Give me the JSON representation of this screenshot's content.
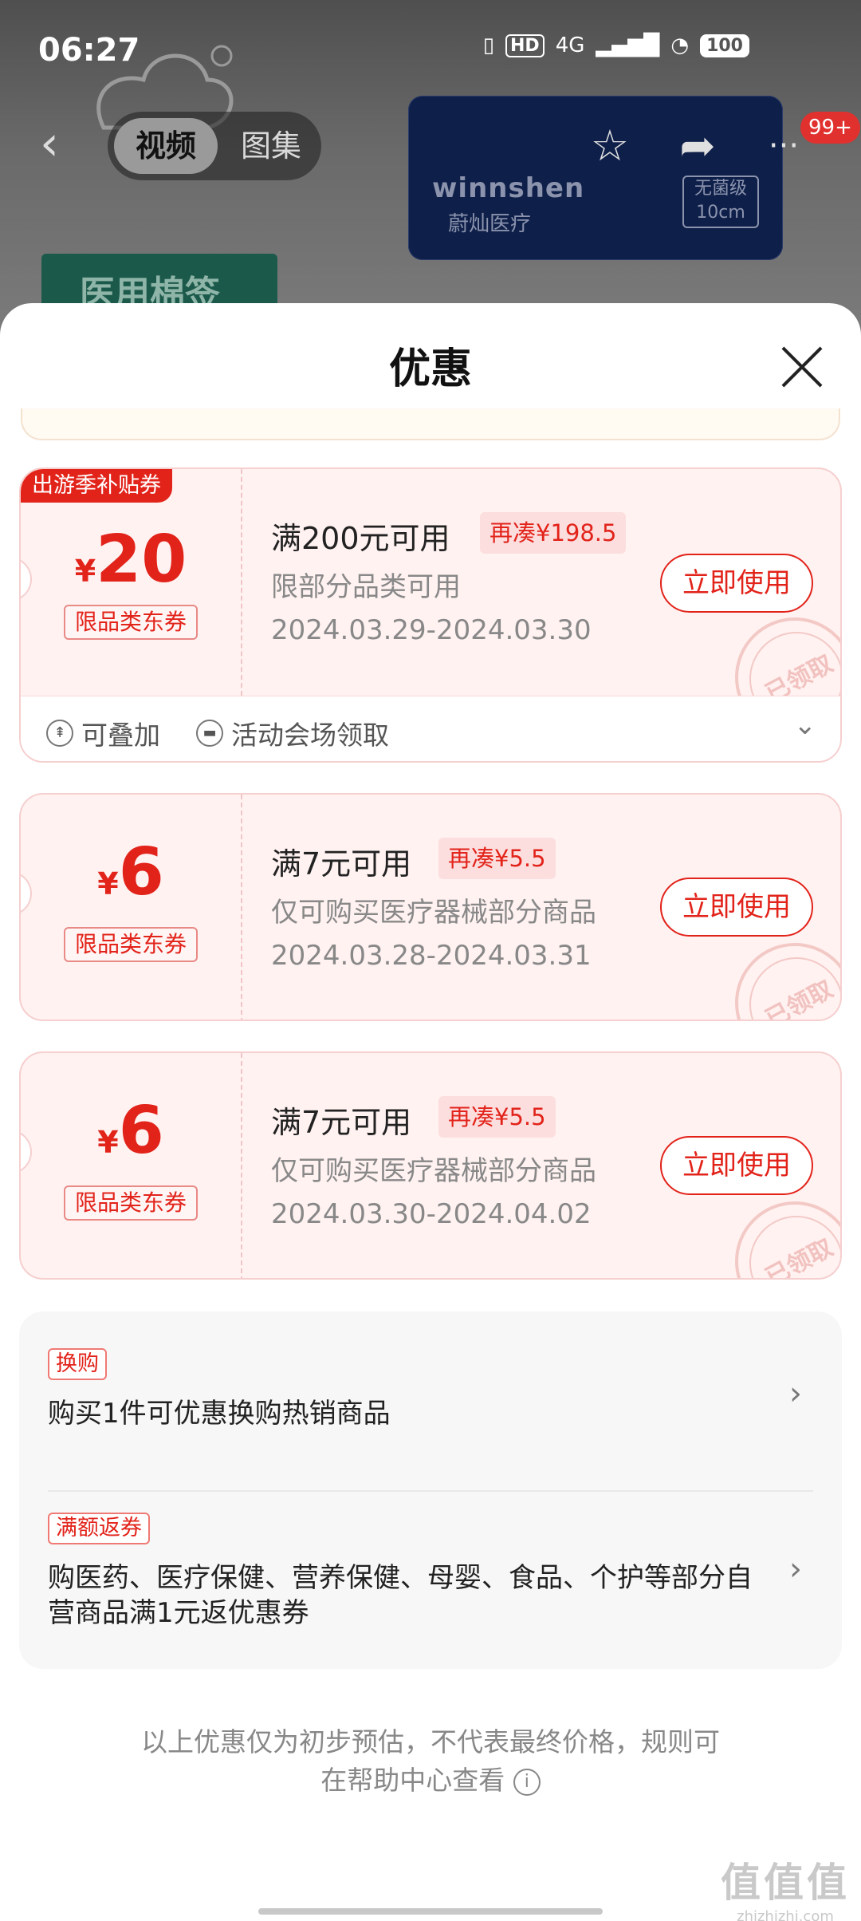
{
  "status_bar": {
    "time": "06:27",
    "hd": "HD",
    "network": "4G",
    "battery": "100"
  },
  "background": {
    "tabs": [
      "视频",
      "图集"
    ],
    "badge": "99+",
    "brand": "winnshen",
    "brand_sub": "蔚灿医疗",
    "box_badge_line1": "无菌级",
    "box_badge_line2": "10cm",
    "green_label": "医用棉签"
  },
  "sheet": {
    "title": "优惠"
  },
  "coupons": [
    {
      "ribbon": "出游季补贴券",
      "currency": "¥",
      "amount": "20",
      "limit_tag": "限品类东券",
      "condition": "满200元可用",
      "add_more": "再凑¥198.5",
      "scope": "限部分品类可用",
      "dates": "2024.03.29-2024.03.30",
      "button": "立即使用",
      "stamp": "已领取",
      "foot_stackable": "可叠加",
      "foot_source": "活动会场领取"
    },
    {
      "currency": "¥",
      "amount": "6",
      "limit_tag": "限品类东券",
      "condition": "满7元可用",
      "add_more": "再凑¥5.5",
      "scope": "仅可购买医疗器械部分商品",
      "dates": "2024.03.28-2024.03.31",
      "button": "立即使用",
      "stamp": "已领取"
    },
    {
      "currency": "¥",
      "amount": "6",
      "limit_tag": "限品类东券",
      "condition": "满7元可用",
      "add_more": "再凑¥5.5",
      "scope": "仅可购买医疗器械部分商品",
      "dates": "2024.03.30-2024.04.02",
      "button": "立即使用",
      "stamp": "已领取"
    }
  ],
  "promos": [
    {
      "tag": "换购",
      "text": "购买1件可优惠换购热销商品"
    },
    {
      "tag": "满额返券",
      "text": "购医药、医疗保健、营养保健、母婴、食品、个护等部分自营商品满1元返优惠券"
    }
  ],
  "disclaimer": {
    "line1": "以上优惠仅为初步预估，不代表最终价格，规则可",
    "line2": "在帮助中心查看"
  },
  "watermark": {
    "line1": "值值值",
    "line2": "zhizhizhi.com"
  }
}
